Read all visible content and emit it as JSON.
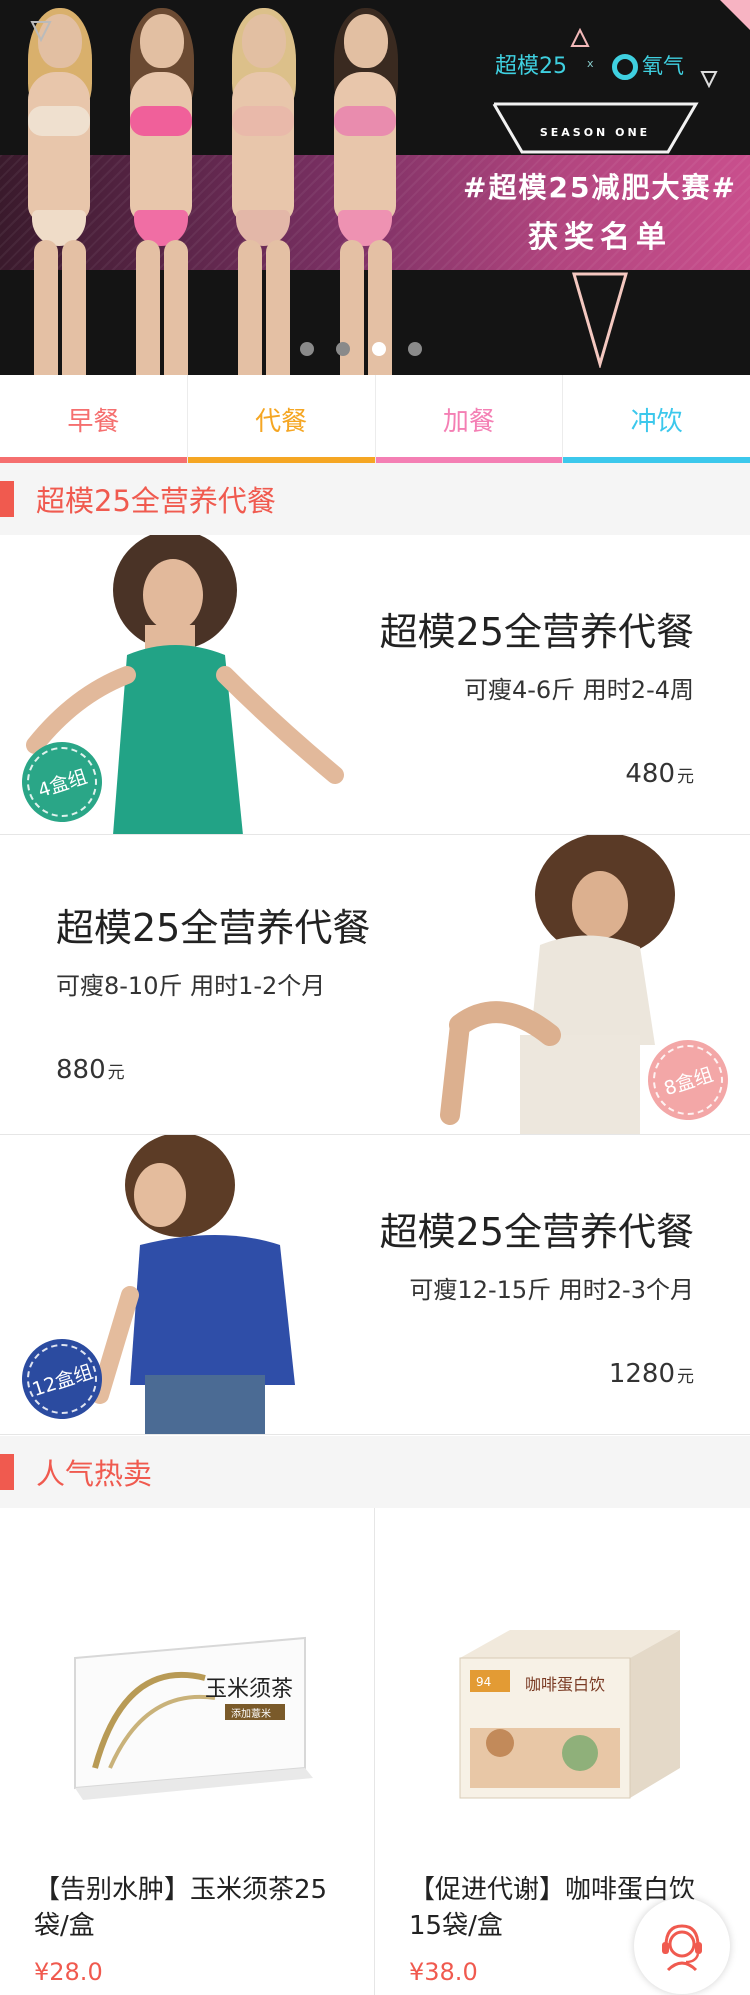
{
  "banner": {
    "brand_left": "超模25",
    "brand_x": "x",
    "brand_right": "氧气",
    "season": "SEASON ONE",
    "title": "#超模25减肥大赛#",
    "subtitle": "获奖名单",
    "carousel_total": 4,
    "carousel_active_index": 2
  },
  "tabs": [
    {
      "label": "早餐",
      "color": "#f56f6f"
    },
    {
      "label": "代餐",
      "color": "#f5a623"
    },
    {
      "label": "加餐",
      "color": "#f47fb4"
    },
    {
      "label": "冲饮",
      "color": "#3cc8ec"
    }
  ],
  "section_meal": {
    "title": "超模25全营养代餐"
  },
  "products": [
    {
      "name": "超模25全营养代餐",
      "desc": "可瘦4-6斤 用时2-4周",
      "price": "480",
      "unit": "元",
      "badge": "4盒组",
      "badge_color": "#2aa687"
    },
    {
      "name": "超模25全营养代餐",
      "desc": "可瘦8-10斤 用时1-2个月",
      "price": "880",
      "unit": "元",
      "badge": "8盒组",
      "badge_color": "#f3a7a7"
    },
    {
      "name": "超模25全营养代餐",
      "desc": "可瘦12-15斤 用时2-3个月",
      "price": "1280",
      "unit": "元",
      "badge": "12盒组",
      "badge_color": "#2b4ba0"
    }
  ],
  "section_hot": {
    "title": "人气热卖"
  },
  "hot_items": [
    {
      "title": "【告别水肿】玉米须茶25袋/盒",
      "price": "¥28.0",
      "box_text": "玉米须茶",
      "box_sub": "添加薏米"
    },
    {
      "title": "【促进代谢】咖啡蛋白饮 15袋/盒",
      "price": "¥38.0",
      "box_text": "咖啡蛋白饮",
      "box_sub": "94"
    }
  ],
  "colors": {
    "accent": "#f05a4f",
    "section_bg": "#f5f5f5",
    "banner_bg": "#141414",
    "banner_stripe": "#b2457f"
  }
}
